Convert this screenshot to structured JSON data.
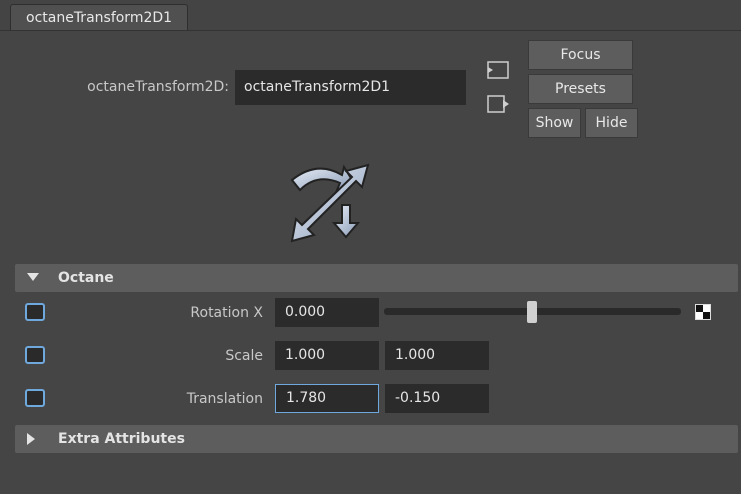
{
  "tab": {
    "label": "octaneTransform2D1"
  },
  "node": {
    "label": "octaneTransform2D:",
    "value": "octaneTransform2D1"
  },
  "buttons": {
    "focus": "Focus",
    "presets": "Presets",
    "show": "Show",
    "hide": "Hide"
  },
  "sections": {
    "octane": "Octane",
    "extra": "Extra Attributes"
  },
  "attributes": {
    "rotation": {
      "label": "Rotation X",
      "value": "0.000",
      "slider_fraction": 0.5
    },
    "scale": {
      "label": "Scale",
      "x": "1.000",
      "y": "1.000"
    },
    "translation": {
      "label": "Translation",
      "x": "1.780",
      "y": "-0.150"
    }
  },
  "colors": {
    "accent": "#6fa8dc",
    "background": "#444444",
    "field": "#2b2b2b"
  }
}
